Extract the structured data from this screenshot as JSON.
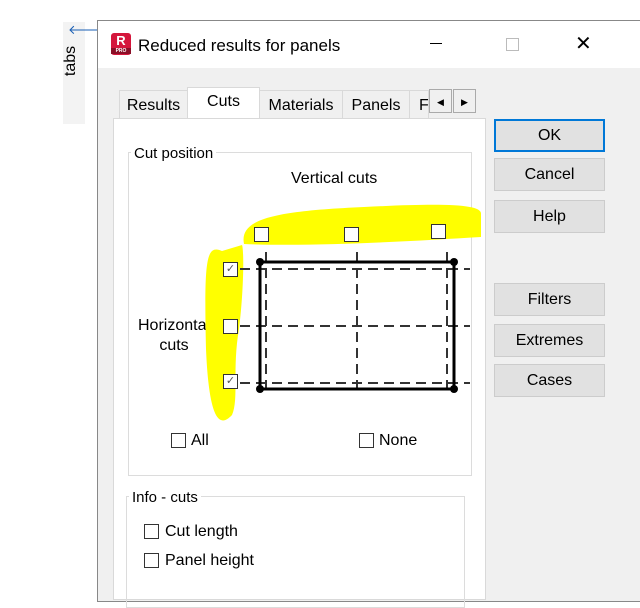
{
  "side_strip": {
    "label": "tabs"
  },
  "window": {
    "title": "Reduced results for panels",
    "app_icon_letter": "R",
    "app_icon_badge": "PRO"
  },
  "tabs": [
    {
      "label": "Results"
    },
    {
      "label": "Cuts",
      "active": true
    },
    {
      "label": "Materials"
    },
    {
      "label": "Panels"
    },
    {
      "label": "F"
    }
  ],
  "cut_position": {
    "group_label": "Cut position",
    "vertical_label": "Vertical cuts",
    "horizontal_label": "Horizontal cuts",
    "vertical_checks": [
      false,
      false,
      false
    ],
    "horizontal_checks": [
      true,
      false,
      true
    ],
    "all_label": "All",
    "none_label": "None"
  },
  "info": {
    "group_label": "Info - cuts",
    "items": [
      {
        "label": "Cut length",
        "checked": false
      },
      {
        "label": "Panel height",
        "checked": false
      }
    ]
  },
  "buttons": {
    "ok": "OK",
    "cancel": "Cancel",
    "help": "Help",
    "filters": "Filters",
    "extremes": "Extremes",
    "cases": "Cases"
  },
  "colors": {
    "highlight": "#ffff00",
    "accent": "#0078d7"
  }
}
